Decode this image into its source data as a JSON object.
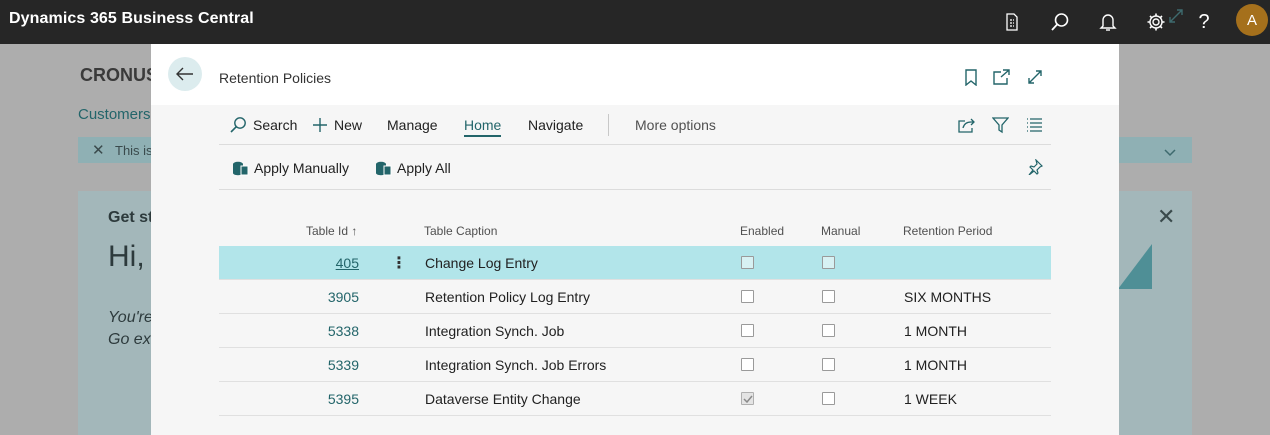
{
  "app": {
    "title": "Dynamics 365 Business Central",
    "user_initial": "A"
  },
  "colors": {
    "accent": "#23656a",
    "topbar": "#262626",
    "selected_row": "#b2e5ea",
    "avatar": "#a5701c"
  },
  "background": {
    "company": "CRONUS",
    "link": "Customers",
    "notification_text": "This is",
    "card_heading": "Get st",
    "card_greeting": "Hi,",
    "card_line1": "You're",
    "card_line2": "Go ex"
  },
  "dialog": {
    "title": "Retention Policies",
    "actions": {
      "search": "Search",
      "new": "New",
      "manage": "Manage",
      "home": "Home",
      "navigate": "Navigate",
      "more": "More options"
    },
    "sub_actions": {
      "apply_manually": "Apply Manually",
      "apply_all": "Apply All"
    },
    "columns": {
      "table_id": "Table Id ↑",
      "table_caption": "Table Caption",
      "enabled": "Enabled",
      "manual": "Manual",
      "retention_period": "Retention Period"
    },
    "rows": [
      {
        "id": "405",
        "caption": "Change Log Entry",
        "enabled": false,
        "manual": false,
        "period": ""
      },
      {
        "id": "3905",
        "caption": "Retention Policy Log Entry",
        "enabled": false,
        "manual": false,
        "period": "SIX MONTHS"
      },
      {
        "id": "5338",
        "caption": "Integration Synch. Job",
        "enabled": false,
        "manual": false,
        "period": "1 MONTH"
      },
      {
        "id": "5339",
        "caption": "Integration Synch. Job Errors",
        "enabled": false,
        "manual": false,
        "period": "1 MONTH"
      },
      {
        "id": "5395",
        "caption": "Dataverse Entity Change",
        "enabled": true,
        "manual": false,
        "period": "1 WEEK"
      }
    ]
  }
}
